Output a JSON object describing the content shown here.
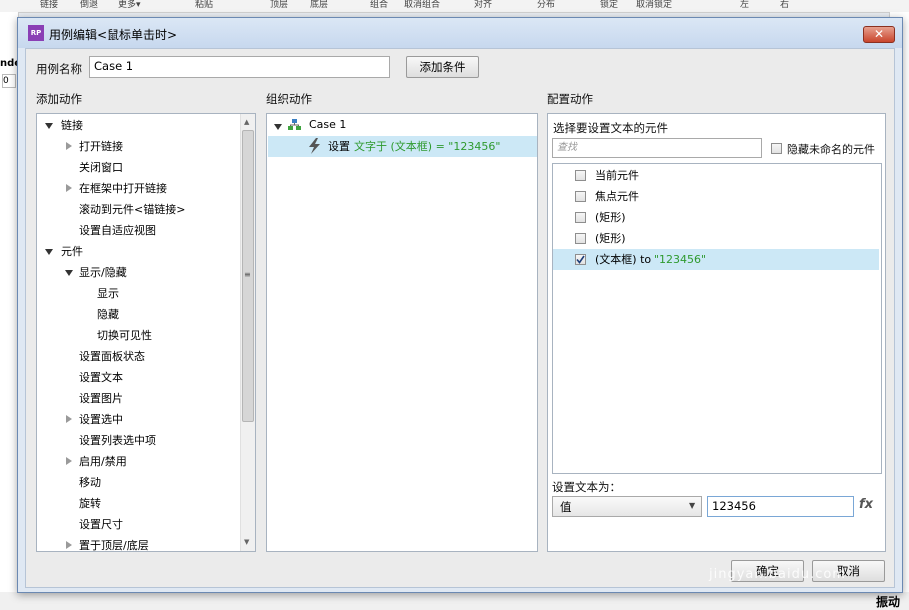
{
  "app": {
    "toolbar_items": [
      "组合",
      "取消组合",
      "对齐",
      "分布",
      "锁定",
      "取消锁定",
      "左",
      "右"
    ],
    "left_text": "nde",
    "left_field": "0",
    "bottom_right_text": "振动"
  },
  "dialog": {
    "title": "用例编辑<鼠标单击时>",
    "title_icon_text": "RP",
    "close_label": "✕",
    "case_name_label": "用例名称",
    "case_name_value": "Case 1",
    "add_condition_label": "添加条件",
    "ok_label": "确定",
    "cancel_label": "取消",
    "watermark": "jingyan.baidu.com"
  },
  "add_actions": {
    "header": "添加动作",
    "items": [
      {
        "label": "链接",
        "expander": "open"
      },
      {
        "label": "打开链接",
        "expander": "closed"
      },
      {
        "label": "关闭窗口",
        "expander": "none"
      },
      {
        "label": "在框架中打开链接",
        "expander": "closed"
      },
      {
        "label": "滚动到元件<锚链接>",
        "expander": "none"
      },
      {
        "label": "设置自适应视图",
        "expander": "none"
      },
      {
        "label": "元件",
        "expander": "open"
      },
      {
        "label": "显示/隐藏",
        "expander": "open"
      },
      {
        "label": "显示",
        "expander": "none"
      },
      {
        "label": "隐藏",
        "expander": "none"
      },
      {
        "label": "切换可见性",
        "expander": "none"
      },
      {
        "label": "设置面板状态",
        "expander": "none"
      },
      {
        "label": "设置文本",
        "expander": "none"
      },
      {
        "label": "设置图片",
        "expander": "none"
      },
      {
        "label": "设置选中",
        "expander": "closed"
      },
      {
        "label": "设置列表选中项",
        "expander": "none"
      },
      {
        "label": "启用/禁用",
        "expander": "closed"
      },
      {
        "label": "移动",
        "expander": "none"
      },
      {
        "label": "旋转",
        "expander": "none"
      },
      {
        "label": "设置尺寸",
        "expander": "none"
      },
      {
        "label": "置于顶层/底层",
        "expander": "closed"
      }
    ]
  },
  "organize_actions": {
    "header": "组织动作",
    "case_label": "Case 1",
    "action_prefix": "设置",
    "action_detail": "文字于 (文本框) = \"123456\""
  },
  "configure_actions": {
    "header": "配置动作",
    "choose_label": "选择要设置文本的元件",
    "search_placeholder": "查找",
    "hide_unnamed_label": "隐藏未命名的元件",
    "widgets": [
      {
        "label": "当前元件",
        "detail": "",
        "checked": false
      },
      {
        "label": "焦点元件",
        "detail": "",
        "checked": false
      },
      {
        "label": "(矩形)",
        "detail": "",
        "checked": false
      },
      {
        "label": "(矩形)",
        "detail": "",
        "checked": false
      },
      {
        "label": "(文本框) to ",
        "detail": "\"123456\"",
        "checked": true
      }
    ],
    "set_text_label": "设置文本为：",
    "value_type": "值",
    "text_value": "123456",
    "fx_label": "fx"
  }
}
